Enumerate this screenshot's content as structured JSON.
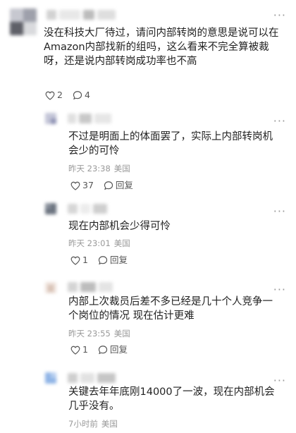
{
  "comments": [
    {
      "text": "没在科技大厂待过，请问内部转岗的意思是说可以在Amazon内部找新的组吗，这么看来不完全算被裁呀，还是说内部转岗成功率也不高",
      "likes": "2",
      "replies": "4",
      "more": "···"
    },
    {
      "text": "不过是明面上的体面罢了，实际上内部转岗机会少的可怜",
      "time": "昨天 23:38",
      "location": "美国",
      "likes": "37",
      "reply_label": "回复",
      "more": "···"
    },
    {
      "text": "现在内部机会少得可怜",
      "time": "昨天 23:01",
      "location": "美国",
      "likes": "1",
      "reply_label": "回复",
      "more": "···"
    },
    {
      "text": "内部上次裁员后差不多已经是几十个人竞争一个岗位的情况 现在估计更难",
      "time": "昨天 23:55",
      "location": "美国",
      "likes": "1",
      "reply_label": "回复",
      "more": "···"
    },
    {
      "text": "关键去年年底刚14000了一波，现在内部机会几乎没有。",
      "time": "7小时前",
      "location": "美国",
      "more": "···"
    }
  ]
}
